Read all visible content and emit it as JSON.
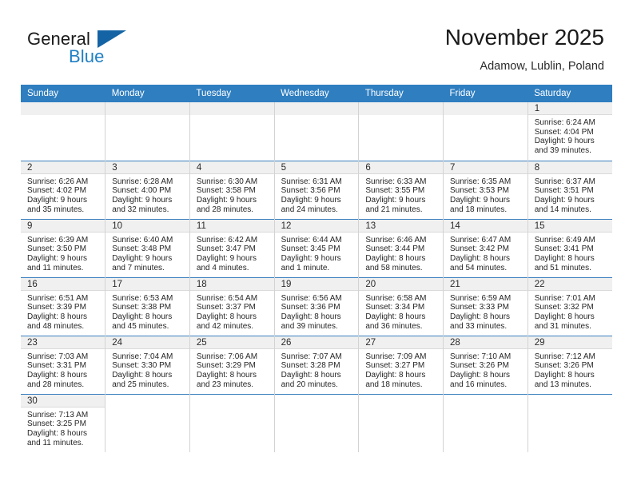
{
  "brand": {
    "name_part1": "General",
    "name_part2": "Blue",
    "accent_color": "#1f7fc4",
    "triangle_color": "#1464a5"
  },
  "header": {
    "title": "November 2025",
    "subtitle": "Adamow, Lublin, Poland"
  },
  "theme": {
    "header_row_bg": "#2f7ec0",
    "row_divider": "#3a7fbf",
    "daynum_band_bg": "#f0f0f0"
  },
  "weekdays": [
    "Sunday",
    "Monday",
    "Tuesday",
    "Wednesday",
    "Thursday",
    "Friday",
    "Saturday"
  ],
  "days": {
    "d1": {
      "num": "1",
      "sunrise": "Sunrise: 6:24 AM",
      "sunset": "Sunset: 4:04 PM",
      "daylight1": "Daylight: 9 hours",
      "daylight2": "and 39 minutes."
    },
    "d2": {
      "num": "2",
      "sunrise": "Sunrise: 6:26 AM",
      "sunset": "Sunset: 4:02 PM",
      "daylight1": "Daylight: 9 hours",
      "daylight2": "and 35 minutes."
    },
    "d3": {
      "num": "3",
      "sunrise": "Sunrise: 6:28 AM",
      "sunset": "Sunset: 4:00 PM",
      "daylight1": "Daylight: 9 hours",
      "daylight2": "and 32 minutes."
    },
    "d4": {
      "num": "4",
      "sunrise": "Sunrise: 6:30 AM",
      "sunset": "Sunset: 3:58 PM",
      "daylight1": "Daylight: 9 hours",
      "daylight2": "and 28 minutes."
    },
    "d5": {
      "num": "5",
      "sunrise": "Sunrise: 6:31 AM",
      "sunset": "Sunset: 3:56 PM",
      "daylight1": "Daylight: 9 hours",
      "daylight2": "and 24 minutes."
    },
    "d6": {
      "num": "6",
      "sunrise": "Sunrise: 6:33 AM",
      "sunset": "Sunset: 3:55 PM",
      "daylight1": "Daylight: 9 hours",
      "daylight2": "and 21 minutes."
    },
    "d7": {
      "num": "7",
      "sunrise": "Sunrise: 6:35 AM",
      "sunset": "Sunset: 3:53 PM",
      "daylight1": "Daylight: 9 hours",
      "daylight2": "and 18 minutes."
    },
    "d8": {
      "num": "8",
      "sunrise": "Sunrise: 6:37 AM",
      "sunset": "Sunset: 3:51 PM",
      "daylight1": "Daylight: 9 hours",
      "daylight2": "and 14 minutes."
    },
    "d9": {
      "num": "9",
      "sunrise": "Sunrise: 6:39 AM",
      "sunset": "Sunset: 3:50 PM",
      "daylight1": "Daylight: 9 hours",
      "daylight2": "and 11 minutes."
    },
    "d10": {
      "num": "10",
      "sunrise": "Sunrise: 6:40 AM",
      "sunset": "Sunset: 3:48 PM",
      "daylight1": "Daylight: 9 hours",
      "daylight2": "and 7 minutes."
    },
    "d11": {
      "num": "11",
      "sunrise": "Sunrise: 6:42 AM",
      "sunset": "Sunset: 3:47 PM",
      "daylight1": "Daylight: 9 hours",
      "daylight2": "and 4 minutes."
    },
    "d12": {
      "num": "12",
      "sunrise": "Sunrise: 6:44 AM",
      "sunset": "Sunset: 3:45 PM",
      "daylight1": "Daylight: 9 hours",
      "daylight2": "and 1 minute."
    },
    "d13": {
      "num": "13",
      "sunrise": "Sunrise: 6:46 AM",
      "sunset": "Sunset: 3:44 PM",
      "daylight1": "Daylight: 8 hours",
      "daylight2": "and 58 minutes."
    },
    "d14": {
      "num": "14",
      "sunrise": "Sunrise: 6:47 AM",
      "sunset": "Sunset: 3:42 PM",
      "daylight1": "Daylight: 8 hours",
      "daylight2": "and 54 minutes."
    },
    "d15": {
      "num": "15",
      "sunrise": "Sunrise: 6:49 AM",
      "sunset": "Sunset: 3:41 PM",
      "daylight1": "Daylight: 8 hours",
      "daylight2": "and 51 minutes."
    },
    "d16": {
      "num": "16",
      "sunrise": "Sunrise: 6:51 AM",
      "sunset": "Sunset: 3:39 PM",
      "daylight1": "Daylight: 8 hours",
      "daylight2": "and 48 minutes."
    },
    "d17": {
      "num": "17",
      "sunrise": "Sunrise: 6:53 AM",
      "sunset": "Sunset: 3:38 PM",
      "daylight1": "Daylight: 8 hours",
      "daylight2": "and 45 minutes."
    },
    "d18": {
      "num": "18",
      "sunrise": "Sunrise: 6:54 AM",
      "sunset": "Sunset: 3:37 PM",
      "daylight1": "Daylight: 8 hours",
      "daylight2": "and 42 minutes."
    },
    "d19": {
      "num": "19",
      "sunrise": "Sunrise: 6:56 AM",
      "sunset": "Sunset: 3:36 PM",
      "daylight1": "Daylight: 8 hours",
      "daylight2": "and 39 minutes."
    },
    "d20": {
      "num": "20",
      "sunrise": "Sunrise: 6:58 AM",
      "sunset": "Sunset: 3:34 PM",
      "daylight1": "Daylight: 8 hours",
      "daylight2": "and 36 minutes."
    },
    "d21": {
      "num": "21",
      "sunrise": "Sunrise: 6:59 AM",
      "sunset": "Sunset: 3:33 PM",
      "daylight1": "Daylight: 8 hours",
      "daylight2": "and 33 minutes."
    },
    "d22": {
      "num": "22",
      "sunrise": "Sunrise: 7:01 AM",
      "sunset": "Sunset: 3:32 PM",
      "daylight1": "Daylight: 8 hours",
      "daylight2": "and 31 minutes."
    },
    "d23": {
      "num": "23",
      "sunrise": "Sunrise: 7:03 AM",
      "sunset": "Sunset: 3:31 PM",
      "daylight1": "Daylight: 8 hours",
      "daylight2": "and 28 minutes."
    },
    "d24": {
      "num": "24",
      "sunrise": "Sunrise: 7:04 AM",
      "sunset": "Sunset: 3:30 PM",
      "daylight1": "Daylight: 8 hours",
      "daylight2": "and 25 minutes."
    },
    "d25": {
      "num": "25",
      "sunrise": "Sunrise: 7:06 AM",
      "sunset": "Sunset: 3:29 PM",
      "daylight1": "Daylight: 8 hours",
      "daylight2": "and 23 minutes."
    },
    "d26": {
      "num": "26",
      "sunrise": "Sunrise: 7:07 AM",
      "sunset": "Sunset: 3:28 PM",
      "daylight1": "Daylight: 8 hours",
      "daylight2": "and 20 minutes."
    },
    "d27": {
      "num": "27",
      "sunrise": "Sunrise: 7:09 AM",
      "sunset": "Sunset: 3:27 PM",
      "daylight1": "Daylight: 8 hours",
      "daylight2": "and 18 minutes."
    },
    "d28": {
      "num": "28",
      "sunrise": "Sunrise: 7:10 AM",
      "sunset": "Sunset: 3:26 PM",
      "daylight1": "Daylight: 8 hours",
      "daylight2": "and 16 minutes."
    },
    "d29": {
      "num": "29",
      "sunrise": "Sunrise: 7:12 AM",
      "sunset": "Sunset: 3:26 PM",
      "daylight1": "Daylight: 8 hours",
      "daylight2": "and 13 minutes."
    },
    "d30": {
      "num": "30",
      "sunrise": "Sunrise: 7:13 AM",
      "sunset": "Sunset: 3:25 PM",
      "daylight1": "Daylight: 8 hours",
      "daylight2": "and 11 minutes."
    }
  }
}
